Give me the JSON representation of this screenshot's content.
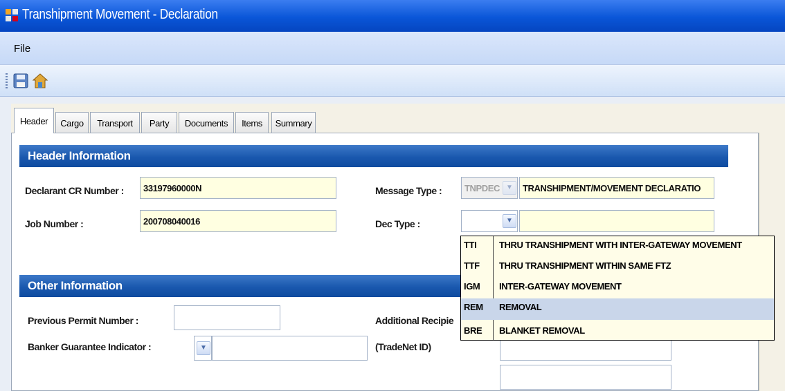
{
  "window": {
    "title": "Transhipment Movement - Declaration"
  },
  "menu": {
    "file": "File"
  },
  "toolbar": {
    "save_icon": "save-icon",
    "home_icon": "home-icon"
  },
  "tabs": [
    "Header",
    "Cargo",
    "Transport",
    "Party",
    "Documents",
    "Items",
    "Summary"
  ],
  "header_info": {
    "title": "Header Information",
    "declarant_cr_label": "Declarant CR Number :",
    "declarant_cr_value": "33197960000N",
    "job_number_label": "Job Number :",
    "job_number_value": "200708040016",
    "message_type_label": "Message Type :",
    "message_type_code": "TNPDEC",
    "message_type_desc": "TRANSHIPMENT/MOVEMENT DECLARATIO",
    "dec_type_label": "Dec Type :",
    "dec_type_code": "",
    "dec_type_desc": ""
  },
  "dec_type_options": [
    {
      "code": "TTI",
      "desc": "THRU TRANSHIPMENT WITH INTER-GATEWAY MOVEMENT"
    },
    {
      "code": "TTF",
      "desc": "THRU TRANSHIPMENT WITHIN SAME FTZ"
    },
    {
      "code": "IGM",
      "desc": "INTER-GATEWAY MOVEMENT"
    },
    {
      "code": "REM",
      "desc": "REMOVAL"
    },
    {
      "code": "BRE",
      "desc": "BLANKET REMOVAL"
    }
  ],
  "other_info": {
    "title": "Other Information",
    "prev_permit_label": "Previous Permit Number :",
    "prev_permit_value": "",
    "banker_label": "Banker Guarantee Indicator :",
    "banker_code": "",
    "banker_desc": "",
    "additional_recipient_label": "Additional Recipie",
    "tradenet_label": "(TradeNet ID)",
    "tradenet_value_1": "",
    "tradenet_value_2": ""
  },
  "colors": {
    "title_bar": "#0a56d8",
    "section_header": "#1a58ae",
    "field_bg": "#ffffe1",
    "dropdown_highlight": "#c9d6ea"
  }
}
